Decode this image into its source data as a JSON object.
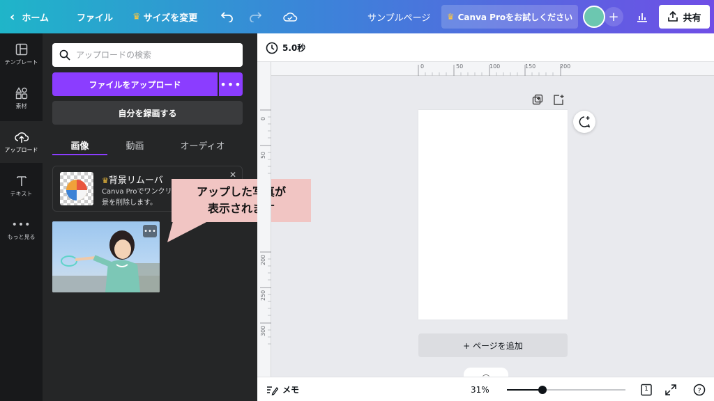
{
  "topbar": {
    "home_label": "ホーム",
    "file_label": "ファイル",
    "resize_label": "サイズを変更",
    "design_title": "サンプルページ",
    "pro_label": "Canva Proをお試しください",
    "share_label": "共有"
  },
  "rail": {
    "items": [
      {
        "label": "テンプレート",
        "icon": "template-icon"
      },
      {
        "label": "素材",
        "icon": "elements-icon"
      },
      {
        "label": "アップロード",
        "icon": "upload-icon",
        "active": true
      },
      {
        "label": "テキスト",
        "icon": "text-icon"
      },
      {
        "label": "もっと見る",
        "icon": "more-icon"
      }
    ]
  },
  "panel": {
    "search_placeholder": "アップロードの検索",
    "upload_button": "ファイルをアップロード",
    "record_button": "自分を録画する",
    "tabs": [
      {
        "label": "画像",
        "active": true
      },
      {
        "label": "動画"
      },
      {
        "label": "オーディオ"
      }
    ],
    "promo": {
      "title": "背景リムーバ",
      "desc_line1": "Canva Proでワンクリ",
      "desc_line2": "景を削除します。"
    },
    "callout_line1": "アップした写真が",
    "callout_line2": "表示されます"
  },
  "editor": {
    "duration": "5.0秒",
    "add_page": "+ ページを追加",
    "ruler_h": [
      "0",
      "50",
      "100",
      "150",
      "200"
    ],
    "ruler_v": [
      "0",
      "50",
      "200",
      "250",
      "300"
    ]
  },
  "bottombar": {
    "notes_label": "メモ",
    "zoom": "31%",
    "zoom_fraction": 0.3,
    "page_count": "1"
  },
  "colors": {
    "accent": "#8b3dff",
    "panel_bg": "#252627",
    "rail_bg": "#18191b",
    "callout": "#f1c5c3"
  }
}
